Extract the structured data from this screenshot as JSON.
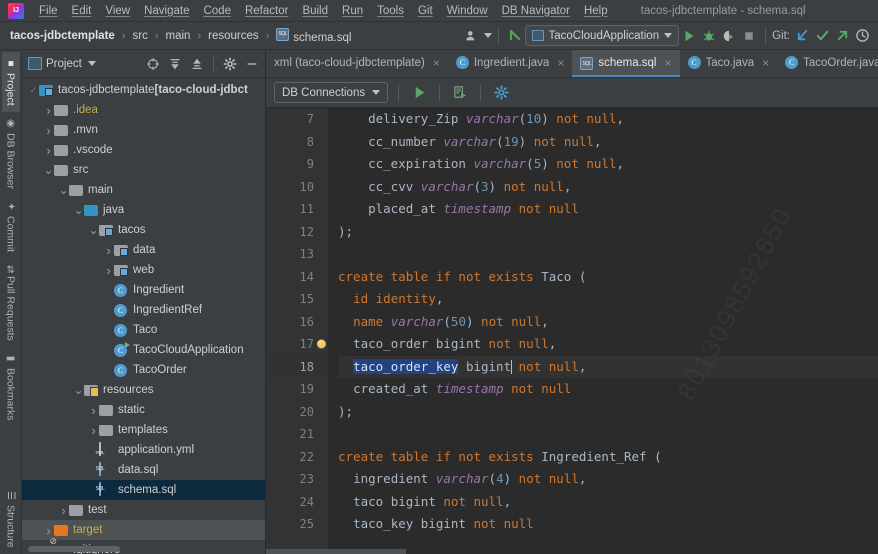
{
  "window": {
    "title": "tacos-jdbctemplate - schema.sql"
  },
  "menubar": {
    "items": [
      "File",
      "Edit",
      "View",
      "Navigate",
      "Code",
      "Refactor",
      "Build",
      "Run",
      "Tools",
      "Git",
      "Window",
      "DB Navigator",
      "Help"
    ]
  },
  "navbar": {
    "breadcrumbs": [
      "tacos-jdbctemplate",
      "src",
      "main",
      "resources",
      "schema.sql"
    ],
    "file_icon": "sql-file-icon",
    "avatar_icon": "user-avatar-icon",
    "back_icon": "back-arrow-icon",
    "run_config": "TacoCloudApplication",
    "run_icon": "run-icon",
    "debug_icon": "debug-icon",
    "coverage_icon": "run-with-coverage-icon",
    "stop_icon": "stop-icon",
    "git_label": "Git:",
    "git_update_icon": "update-project-icon",
    "git_commit_icon": "commit-icon",
    "git_push_icon": "push-icon",
    "git_history_icon": "history-icon"
  },
  "leftstrip": {
    "tabs": [
      {
        "label": "Project",
        "icon": "project-icon",
        "active": true
      },
      {
        "label": "DB Browser",
        "icon": "db-browser-icon",
        "active": false
      },
      {
        "label": "Commit",
        "icon": "commit-icon",
        "active": false
      },
      {
        "label": "Pull Requests",
        "icon": "pull-requests-icon",
        "active": false
      },
      {
        "label": "Bookmarks",
        "icon": "bookmarks-icon",
        "active": false
      }
    ],
    "bottom_tabs": [
      {
        "label": "Structure",
        "icon": "structure-icon",
        "active": false
      }
    ]
  },
  "project_panel": {
    "title": "Project",
    "title_icon": "project-window-icon",
    "dropdown_icon": "chevron-down-icon",
    "locate_icon": "select-opened-file-icon",
    "expand_icon": "expand-all-icon",
    "collapse_icon": "collapse-all-icon",
    "settings_icon": "gear-icon",
    "hide_icon": "hide-icon",
    "tree": [
      {
        "depth": 0,
        "twisty": "check",
        "icon": "module-folder",
        "label": "tacos-jdbctemplate ",
        "suffix": "[taco-cloud-jdbct",
        "style": "plain"
      },
      {
        "depth": 1,
        "twisty": "right",
        "icon": "folder",
        "label": ".idea",
        "style": "yellow"
      },
      {
        "depth": 1,
        "twisty": "right",
        "icon": "folder",
        "label": ".mvn",
        "style": "plain"
      },
      {
        "depth": 1,
        "twisty": "right",
        "icon": "folder",
        "label": ".vscode",
        "style": "plain"
      },
      {
        "depth": 1,
        "twisty": "down",
        "icon": "folder",
        "label": "src",
        "style": "plain"
      },
      {
        "depth": 2,
        "twisty": "down",
        "icon": "folder",
        "label": "main",
        "style": "plain"
      },
      {
        "depth": 3,
        "twisty": "down",
        "icon": "folder-blue",
        "label": "java",
        "style": "plain"
      },
      {
        "depth": 4,
        "twisty": "down",
        "icon": "package-folder",
        "label": "tacos",
        "style": "plain"
      },
      {
        "depth": 5,
        "twisty": "right",
        "icon": "package-folder",
        "label": "data",
        "style": "plain"
      },
      {
        "depth": 5,
        "twisty": "right",
        "icon": "package-folder",
        "label": "web",
        "style": "plain"
      },
      {
        "depth": 5,
        "twisty": "none",
        "icon": "class-icon",
        "label": "Ingredient",
        "style": "plain"
      },
      {
        "depth": 5,
        "twisty": "none",
        "icon": "class-icon",
        "label": "IngredientRef",
        "style": "plain"
      },
      {
        "depth": 5,
        "twisty": "none",
        "icon": "class-icon",
        "label": "Taco",
        "style": "plain"
      },
      {
        "depth": 5,
        "twisty": "none",
        "icon": "runnable-class-icon",
        "label": "TacoCloudApplication",
        "style": "plain"
      },
      {
        "depth": 5,
        "twisty": "none",
        "icon": "class-icon",
        "label": "TacoOrder",
        "style": "plain"
      },
      {
        "depth": 3,
        "twisty": "down",
        "icon": "resources-folder",
        "label": "resources",
        "style": "plain"
      },
      {
        "depth": 4,
        "twisty": "right",
        "icon": "folder",
        "label": "static",
        "style": "plain"
      },
      {
        "depth": 4,
        "twisty": "right",
        "icon": "folder",
        "label": "templates",
        "style": "plain"
      },
      {
        "depth": 4,
        "twisty": "none",
        "icon": "yml-file-icon",
        "label": "application.yml",
        "style": "plain"
      },
      {
        "depth": 4,
        "twisty": "none",
        "icon": "sql-file-icon",
        "label": "data.sql",
        "style": "plain"
      },
      {
        "depth": 4,
        "twisty": "none",
        "icon": "sql-file-icon",
        "label": "schema.sql",
        "style": "selected"
      },
      {
        "depth": 2,
        "twisty": "right",
        "icon": "folder",
        "label": "test",
        "style": "plain"
      },
      {
        "depth": 1,
        "twisty": "right",
        "icon": "folder-orange",
        "label": "target",
        "style": "orangefolder"
      },
      {
        "depth": 1,
        "twisty": "none",
        "icon": "gitignore-file-icon",
        "label": ".gitignore",
        "style": "plain"
      }
    ]
  },
  "editor_tabs": [
    {
      "label": "xml (taco-cloud-jdbctemplate)",
      "icon": "xml-file-icon",
      "active": false
    },
    {
      "label": "Ingredient.java",
      "icon": "class-icon",
      "active": false
    },
    {
      "label": "schema.sql",
      "icon": "sql-file-icon",
      "active": true
    },
    {
      "label": "Taco.java",
      "icon": "class-icon",
      "active": false
    },
    {
      "label": "TacoOrder.java",
      "icon": "class-icon",
      "active": false
    }
  ],
  "db_toolbar": {
    "connection_label": "DB Connections",
    "dropdown_icon": "chevron-down-icon",
    "execute_icon": "execute-statement-icon",
    "execute_script_icon": "execute-script-icon",
    "settings_icon": "gear-icon"
  },
  "editor": {
    "watermark": "8013098592650",
    "selection": "taco_order_key",
    "current_line": 18,
    "first_visible_line": 7,
    "lines": [
      {
        "num": 7,
        "tokens": [
          {
            "t": "    ",
            "c": "p"
          },
          {
            "t": "delivery_Zip ",
            "c": "id"
          },
          {
            "t": "varchar",
            "c": "t"
          },
          {
            "t": "(",
            "c": "p"
          },
          {
            "t": "10",
            "c": "n"
          },
          {
            "t": ") ",
            "c": "p"
          },
          {
            "t": "not null",
            "c": "k"
          },
          {
            "t": ",",
            "c": "p"
          }
        ]
      },
      {
        "num": 8,
        "tokens": [
          {
            "t": "    ",
            "c": "p"
          },
          {
            "t": "cc_number ",
            "c": "id"
          },
          {
            "t": "varchar",
            "c": "t"
          },
          {
            "t": "(",
            "c": "p"
          },
          {
            "t": "19",
            "c": "n"
          },
          {
            "t": ") ",
            "c": "p"
          },
          {
            "t": "not null",
            "c": "k"
          },
          {
            "t": ",",
            "c": "p"
          }
        ]
      },
      {
        "num": 9,
        "tokens": [
          {
            "t": "    ",
            "c": "p"
          },
          {
            "t": "cc_expiration ",
            "c": "id"
          },
          {
            "t": "varchar",
            "c": "t"
          },
          {
            "t": "(",
            "c": "p"
          },
          {
            "t": "5",
            "c": "n"
          },
          {
            "t": ") ",
            "c": "p"
          },
          {
            "t": "not null",
            "c": "k"
          },
          {
            "t": ",",
            "c": "p"
          }
        ]
      },
      {
        "num": 10,
        "tokens": [
          {
            "t": "    ",
            "c": "p"
          },
          {
            "t": "cc_cvv ",
            "c": "id"
          },
          {
            "t": "varchar",
            "c": "t"
          },
          {
            "t": "(",
            "c": "p"
          },
          {
            "t": "3",
            "c": "n"
          },
          {
            "t": ") ",
            "c": "p"
          },
          {
            "t": "not null",
            "c": "k"
          },
          {
            "t": ",",
            "c": "p"
          }
        ]
      },
      {
        "num": 11,
        "tokens": [
          {
            "t": "    ",
            "c": "p"
          },
          {
            "t": "placed_at ",
            "c": "id"
          },
          {
            "t": "timestamp",
            "c": "t"
          },
          {
            "t": " ",
            "c": "p"
          },
          {
            "t": "not null",
            "c": "k"
          }
        ]
      },
      {
        "num": 12,
        "tokens": [
          {
            "t": ");",
            "c": "p"
          }
        ]
      },
      {
        "num": 13,
        "tokens": []
      },
      {
        "num": 14,
        "tokens": [
          {
            "t": "create table",
            "c": "k"
          },
          {
            "t": " ",
            "c": "p"
          },
          {
            "t": "if not exists",
            "c": "k"
          },
          {
            "t": " Taco (",
            "c": "id"
          }
        ]
      },
      {
        "num": 15,
        "tokens": [
          {
            "t": "  ",
            "c": "p"
          },
          {
            "t": "id identity",
            "c": "k"
          },
          {
            "t": ",",
            "c": "p"
          }
        ]
      },
      {
        "num": 16,
        "tokens": [
          {
            "t": "  ",
            "c": "p"
          },
          {
            "t": "name ",
            "c": "k"
          },
          {
            "t": "varchar",
            "c": "t"
          },
          {
            "t": "(",
            "c": "p"
          },
          {
            "t": "50",
            "c": "n"
          },
          {
            "t": ") ",
            "c": "p"
          },
          {
            "t": "not null",
            "c": "k"
          },
          {
            "t": ",",
            "c": "p"
          }
        ]
      },
      {
        "num": 17,
        "gutter_icon": "intention-bulb-icon",
        "tokens": [
          {
            "t": "  ",
            "c": "p"
          },
          {
            "t": "taco_order ",
            "c": "id"
          },
          {
            "t": "bigint ",
            "c": "id"
          },
          {
            "t": "not null",
            "c": "k"
          },
          {
            "t": ",",
            "c": "p"
          }
        ]
      },
      {
        "num": 18,
        "current": true,
        "tokens": [
          {
            "t": "  ",
            "c": "p"
          },
          {
            "t": "taco_order_key",
            "c": "sel"
          },
          {
            "t": " bigint",
            "c": "id"
          },
          {
            "t": "|",
            "c": "caret"
          },
          {
            "t": " ",
            "c": "p"
          },
          {
            "t": "not null",
            "c": "k"
          },
          {
            "t": ",",
            "c": "p"
          }
        ]
      },
      {
        "num": 19,
        "tokens": [
          {
            "t": "  ",
            "c": "p"
          },
          {
            "t": "created_at ",
            "c": "id"
          },
          {
            "t": "timestamp",
            "c": "t"
          },
          {
            "t": " ",
            "c": "p"
          },
          {
            "t": "not null",
            "c": "k"
          }
        ]
      },
      {
        "num": 20,
        "tokens": [
          {
            "t": ");",
            "c": "p"
          }
        ]
      },
      {
        "num": 21,
        "tokens": []
      },
      {
        "num": 22,
        "tokens": [
          {
            "t": "create table",
            "c": "k"
          },
          {
            "t": " ",
            "c": "p"
          },
          {
            "t": "if not exists",
            "c": "k"
          },
          {
            "t": " Ingredient_Ref (",
            "c": "id"
          }
        ]
      },
      {
        "num": 23,
        "tokens": [
          {
            "t": "  ",
            "c": "p"
          },
          {
            "t": "ingredient ",
            "c": "id"
          },
          {
            "t": "varchar",
            "c": "t"
          },
          {
            "t": "(",
            "c": "p"
          },
          {
            "t": "4",
            "c": "n"
          },
          {
            "t": ") ",
            "c": "p"
          },
          {
            "t": "not null",
            "c": "k"
          },
          {
            "t": ",",
            "c": "p"
          }
        ]
      },
      {
        "num": 24,
        "tokens": [
          {
            "t": "  ",
            "c": "p"
          },
          {
            "t": "taco bigint ",
            "c": "id"
          },
          {
            "t": "not null",
            "c": "k"
          },
          {
            "t": ",",
            "c": "p"
          }
        ]
      },
      {
        "num": 25,
        "tokens": [
          {
            "t": "  ",
            "c": "p"
          },
          {
            "t": "taco_key bigint ",
            "c": "id"
          },
          {
            "t": "not null",
            "c": "k"
          }
        ]
      }
    ]
  }
}
